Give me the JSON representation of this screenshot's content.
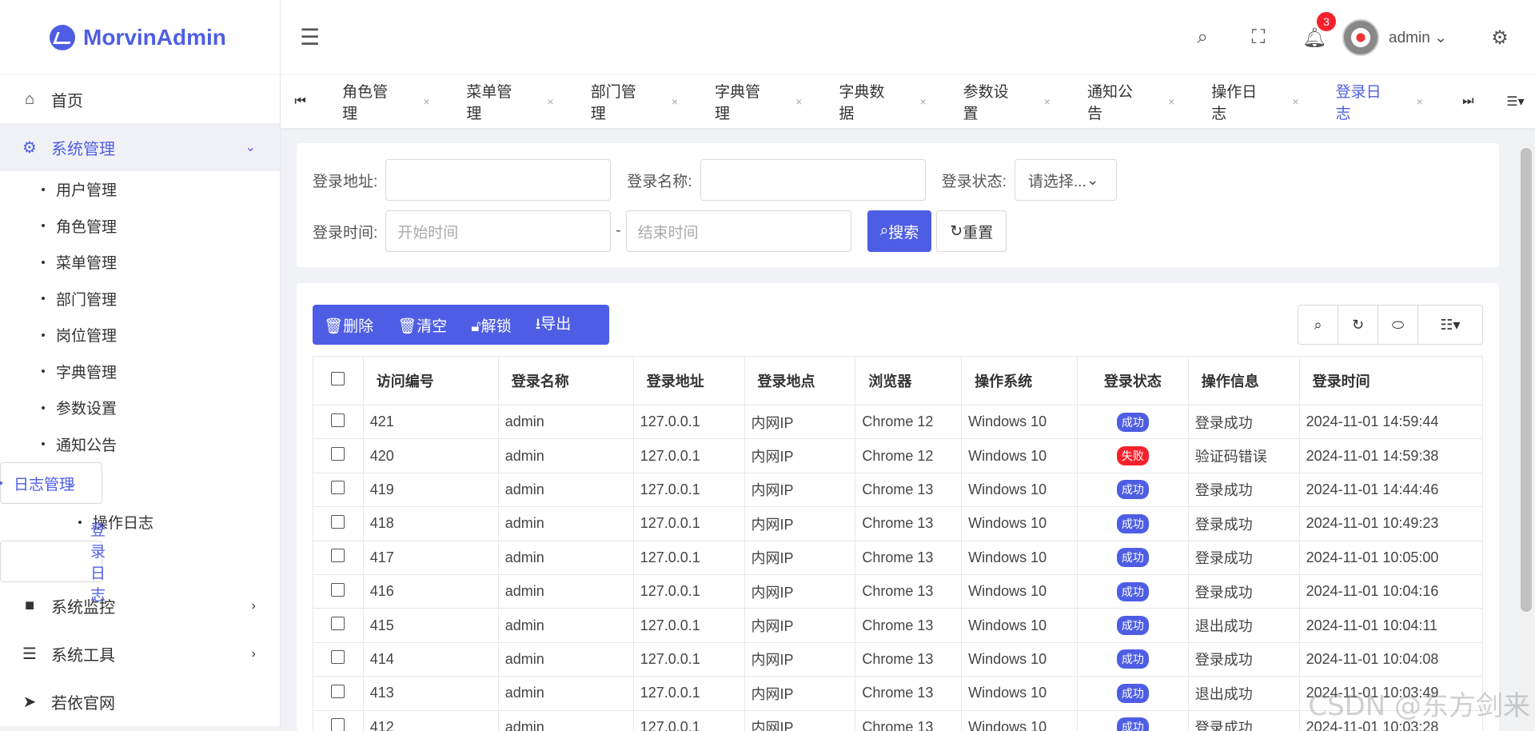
{
  "app": {
    "name": "MorvinAdmin"
  },
  "header": {
    "notif_count": "3",
    "user": "admin"
  },
  "sidebar": {
    "home": "首页",
    "system": "系统管理",
    "system_items": [
      "用户管理",
      "角色管理",
      "菜单管理",
      "部门管理",
      "岗位管理",
      "字典管理",
      "参数设置",
      "通知公告"
    ],
    "log": "日志管理",
    "log_items": [
      "操作日志",
      "登录日志"
    ],
    "monitor": "系统监控",
    "tools": "系统工具",
    "site": "若依官网"
  },
  "tabs": [
    "角色管理",
    "菜单管理",
    "部门管理",
    "字典管理",
    "字典数据",
    "参数设置",
    "通知公告",
    "操作日志",
    "登录日志"
  ],
  "search": {
    "addr_label": "登录地址:",
    "name_label": "登录名称:",
    "status_label": "登录状态:",
    "status_value": "请选择...",
    "time_label": "登录时间:",
    "start_placeholder": "开始时间",
    "end_placeholder": "结束时间",
    "dash": "-",
    "search_btn": "搜索",
    "reset_btn": "重置"
  },
  "toolbar": {
    "delete": "删除",
    "clear": "清空",
    "unlock": "解锁",
    "export": "导出"
  },
  "table": {
    "headers": [
      "访问编号",
      "登录名称",
      "登录地址",
      "登录地点",
      "浏览器",
      "操作系统",
      "登录状态",
      "操作信息",
      "登录时间"
    ],
    "rows": [
      [
        "421",
        "admin",
        "127.0.0.1",
        "内网IP",
        "Chrome 12",
        "Windows 10",
        "成功",
        "登录成功",
        "2024-11-01 14:59:44"
      ],
      [
        "420",
        "admin",
        "127.0.0.1",
        "内网IP",
        "Chrome 12",
        "Windows 10",
        "失败",
        "验证码错误",
        "2024-11-01 14:59:38"
      ],
      [
        "419",
        "admin",
        "127.0.0.1",
        "内网IP",
        "Chrome 13",
        "Windows 10",
        "成功",
        "登录成功",
        "2024-11-01 14:44:46"
      ],
      [
        "418",
        "admin",
        "127.0.0.1",
        "内网IP",
        "Chrome 13",
        "Windows 10",
        "成功",
        "登录成功",
        "2024-11-01 10:49:23"
      ],
      [
        "417",
        "admin",
        "127.0.0.1",
        "内网IP",
        "Chrome 13",
        "Windows 10",
        "成功",
        "登录成功",
        "2024-11-01 10:05:00"
      ],
      [
        "416",
        "admin",
        "127.0.0.1",
        "内网IP",
        "Chrome 13",
        "Windows 10",
        "成功",
        "登录成功",
        "2024-11-01 10:04:16"
      ],
      [
        "415",
        "admin",
        "127.0.0.1",
        "内网IP",
        "Chrome 13",
        "Windows 10",
        "成功",
        "退出成功",
        "2024-11-01 10:04:11"
      ],
      [
        "414",
        "admin",
        "127.0.0.1",
        "内网IP",
        "Chrome 13",
        "Windows 10",
        "成功",
        "登录成功",
        "2024-11-01 10:04:08"
      ],
      [
        "413",
        "admin",
        "127.0.0.1",
        "内网IP",
        "Chrome 13",
        "Windows 10",
        "成功",
        "退出成功",
        "2024-11-01 10:03:49"
      ],
      [
        "412",
        "admin",
        "127.0.0.1",
        "内网IP",
        "Chrome 13",
        "Windows 10",
        "成功",
        "登录成功",
        "2024-11-01 10:03:28"
      ]
    ]
  },
  "watermark": "CSDN @东方剑来"
}
